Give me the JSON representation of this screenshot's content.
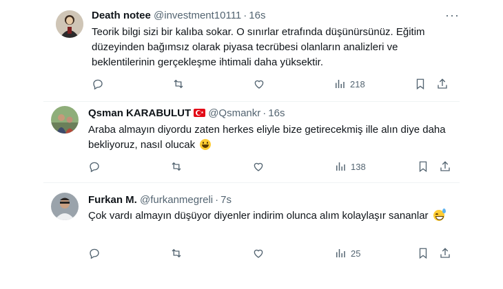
{
  "tweets": [
    {
      "name": "Death notee",
      "handle": "@investment10111",
      "time": "16s",
      "text": "Teorik bilgi sizi bir kalıba sokar. O sınırlar etrafında düşünürsünüz.  Eğitim düzeyinden bağımsız olarak piyasa tecrübesi olanların analizleri ve beklentilerinin gerçekleşme ihtimali daha yüksektir.",
      "views": "218",
      "emoji": ""
    },
    {
      "name": "Qsman KARABULUT",
      "handle": "@Qsmankr",
      "time": "16s",
      "text": "Araba almayın diyordu zaten herkes eliyle bize getirecekmiş ille alın diye daha bekliyoruz, nasıl olucak",
      "views": "138",
      "emoji": "grinning-face"
    },
    {
      "name": "Furkan M.",
      "handle": "@furkanmegreli",
      "time": "7s",
      "text": "Çok vardı almayın düşüyor diyenler indirim olunca alım kolaylaşır sananlar",
      "views": "25",
      "emoji": "grinning-face-with-sweat"
    }
  ],
  "separator": "·",
  "more_glyph": "···",
  "colors": {
    "text": "#0f1419",
    "secondary": "#536471",
    "divider": "#eff3f4",
    "flag": "#e30a17"
  }
}
